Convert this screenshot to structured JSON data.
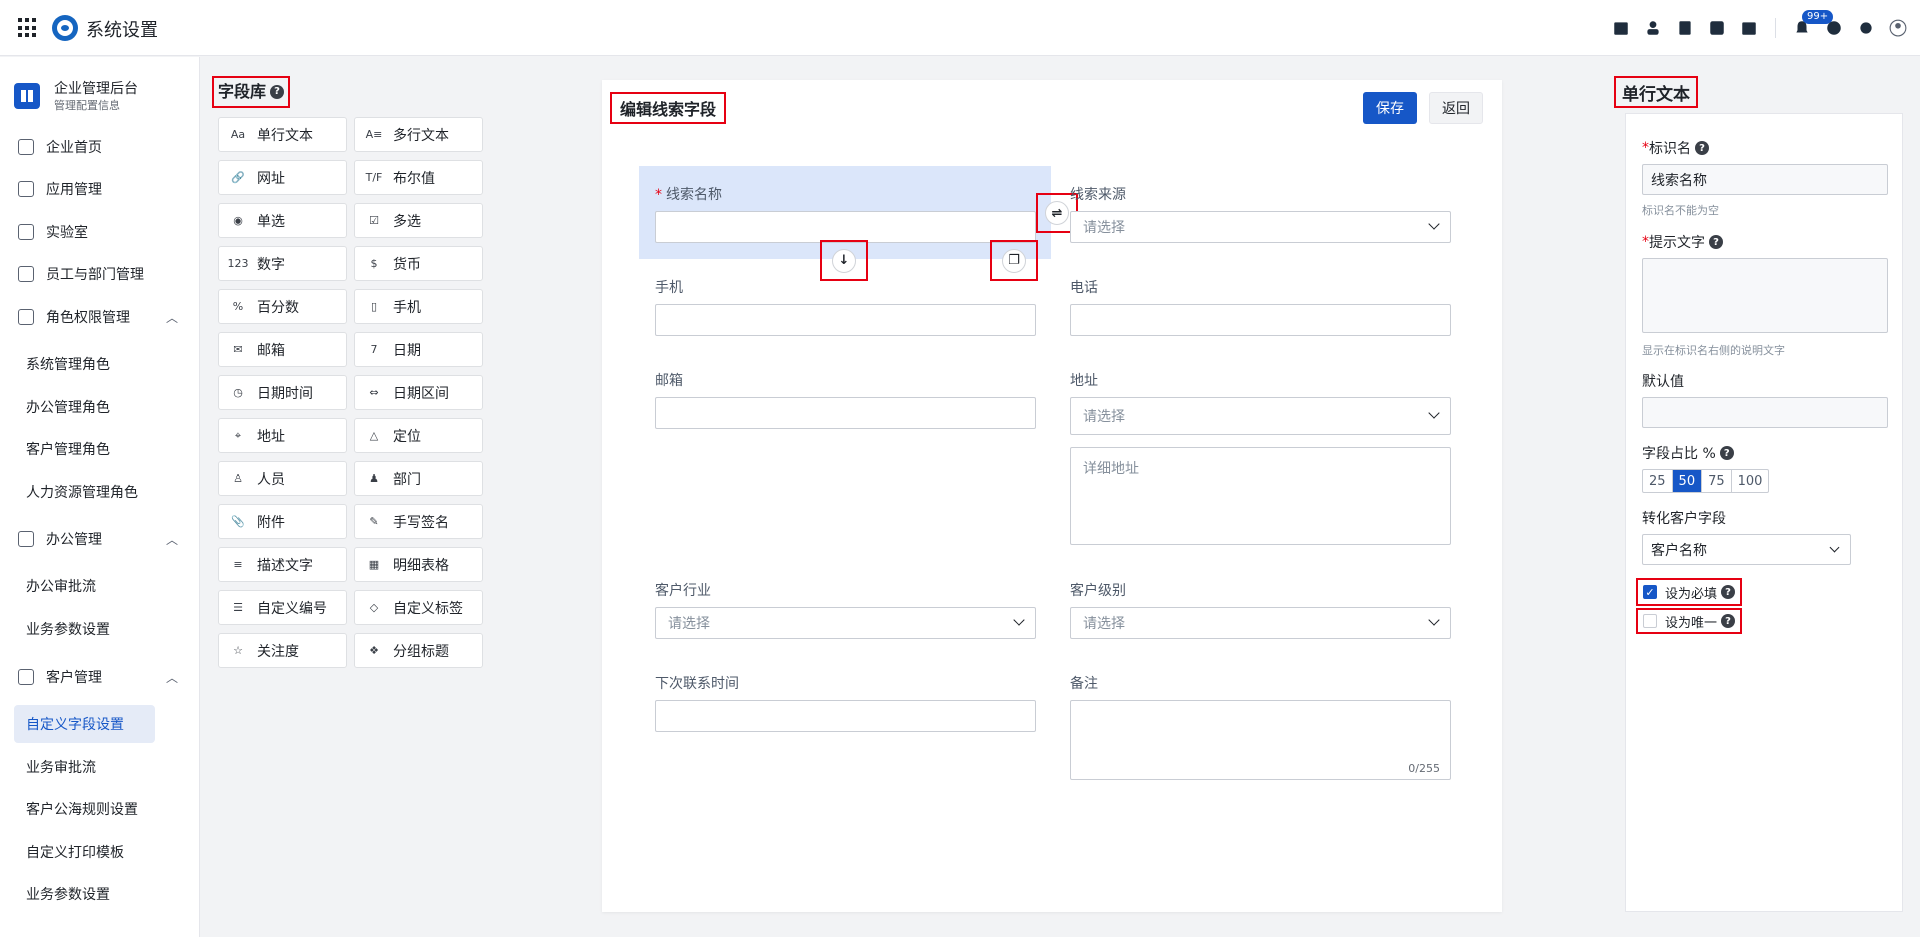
{
  "app": {
    "title": "系统设置",
    "notification_badge": "99+"
  },
  "sidebar": {
    "org_title": "企业管理后台",
    "org_subtitle": "管理配置信息",
    "items": [
      {
        "label": "企业首页"
      },
      {
        "label": "应用管理"
      },
      {
        "label": "实验室"
      },
      {
        "label": "员工与部门管理"
      },
      {
        "label": "角色权限管理"
      },
      {
        "label": "系统管理角色"
      },
      {
        "label": "办公管理角色"
      },
      {
        "label": "客户管理角色"
      },
      {
        "label": "人力资源管理角色"
      },
      {
        "label": "办公管理"
      },
      {
        "label": "办公审批流"
      },
      {
        "label": "业务参数设置"
      },
      {
        "label": "客户管理"
      },
      {
        "label": "自定义字段设置"
      },
      {
        "label": "业务审批流"
      },
      {
        "label": "客户公海规则设置"
      },
      {
        "label": "自定义打印模板"
      },
      {
        "label": "业务参数设置"
      }
    ]
  },
  "field_library": {
    "title": "字段库",
    "items": [
      {
        "label": "单行文本",
        "icon": "Aa"
      },
      {
        "label": "多行文本",
        "icon": "A≡"
      },
      {
        "label": "网址",
        "icon": "🔗"
      },
      {
        "label": "布尔值",
        "icon": "T/F"
      },
      {
        "label": "单选",
        "icon": "◉"
      },
      {
        "label": "多选",
        "icon": "☑"
      },
      {
        "label": "数字",
        "icon": "123"
      },
      {
        "label": "货币",
        "icon": "$"
      },
      {
        "label": "百分数",
        "icon": "%"
      },
      {
        "label": "手机",
        "icon": "▯"
      },
      {
        "label": "邮箱",
        "icon": "✉"
      },
      {
        "label": "日期",
        "icon": "7"
      },
      {
        "label": "日期时间",
        "icon": "◷"
      },
      {
        "label": "日期区间",
        "icon": "⇔"
      },
      {
        "label": "地址",
        "icon": "⌖"
      },
      {
        "label": "定位",
        "icon": "△"
      },
      {
        "label": "人员",
        "icon": "♙"
      },
      {
        "label": "部门",
        "icon": "♟"
      },
      {
        "label": "附件",
        "icon": "📎"
      },
      {
        "label": "手写签名",
        "icon": "✎"
      },
      {
        "label": "描述文字",
        "icon": "≡"
      },
      {
        "label": "明细表格",
        "icon": "▦"
      },
      {
        "label": "自定义编号",
        "icon": "☰"
      },
      {
        "label": "自定义标签",
        "icon": "◇"
      },
      {
        "label": "关注度",
        "icon": "☆"
      },
      {
        "label": "分组标题",
        "icon": "❖"
      }
    ]
  },
  "editor": {
    "title": "编辑线索字段",
    "save_label": "保存",
    "back_label": "返回",
    "select_placeholder": "请选择",
    "fields": {
      "lead_name": "线索名称",
      "lead_source": "线索来源",
      "mobile": "手机",
      "phone": "电话",
      "email": "邮箱",
      "address": "地址",
      "address_detail_placeholder": "详细地址",
      "industry": "客户行业",
      "level": "客户级别",
      "next_contact": "下次联系时间",
      "remark": "备注",
      "remark_counter": "0/255"
    }
  },
  "properties": {
    "title": "单行文本",
    "identifier_label": "标识名",
    "identifier_value": "线索名称",
    "identifier_hint": "标识名不能为空",
    "tip_label": "提示文字",
    "tip_hint": "显示在标识名右侧的说明文字",
    "default_label": "默认值",
    "ratio_label": "字段占比 %",
    "ratio_options": [
      "25",
      "50",
      "75",
      "100"
    ],
    "ratio_selected": "50",
    "convert_label": "转化客户字段",
    "convert_value": "客户名称",
    "required_label": "设为必填",
    "required_checked": true,
    "unique_label": "设为唯一",
    "unique_checked": false
  }
}
